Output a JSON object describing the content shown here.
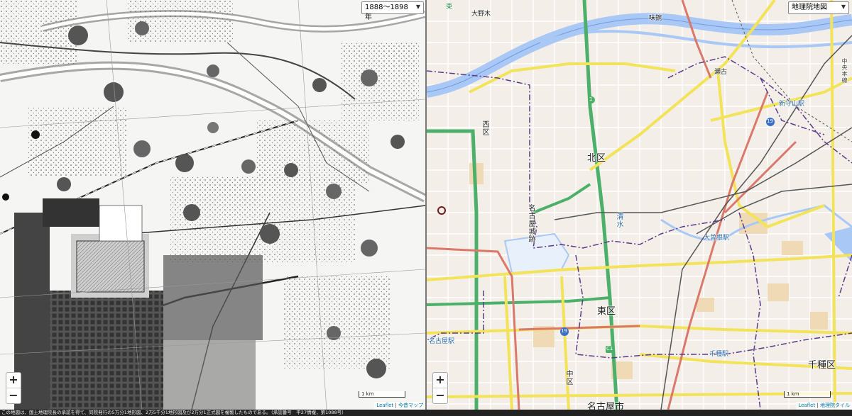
{
  "left_map": {
    "period_select": {
      "value": "1888〜1898年"
    },
    "zoom_in": "+",
    "zoom_out": "−",
    "scale": "1 km",
    "attribution_leaflet": "Leaflet",
    "attribution_sep": " | ",
    "attribution_source": "今昔マップ"
  },
  "right_map": {
    "layer_select": {
      "value": "地理院地図"
    },
    "zoom_in": "+",
    "zoom_out": "−",
    "scale": "1 km",
    "attribution_leaflet": "Leaflet",
    "attribution_sep": " | ",
    "attribution_source": "地理院タイル",
    "labels": {
      "onogi": "大野木",
      "ajiyoshi": "味鋺",
      "seko": "瀬古",
      "shinmoriyama": "新守山駅",
      "nishi_ward": "西区",
      "kita_ward": "北区",
      "nagoya_castle": "名古屋城跡",
      "shimizu": "清水",
      "ozone": "大曽根駅",
      "higashi_ward": "東区",
      "nagoya_station": "名古屋駅",
      "chikusa_station": "千種駅",
      "chikusa_ward": "千種区",
      "naka_ward": "中区",
      "nagoya_city": "名古屋市",
      "route_19_a": "19",
      "route_19_b": "19",
      "route_1": "1",
      "route_c1": "C1",
      "chuo_line": "中央本線",
      "higashi": "東"
    }
  },
  "footer": {
    "note": "この地図は、国土地理院長の承認を得て、同院発行の5万分1地形図、2万5千分1地形図及び2万分1正式図を複製したものである。（承認番号　平27情複，第1088号）"
  }
}
